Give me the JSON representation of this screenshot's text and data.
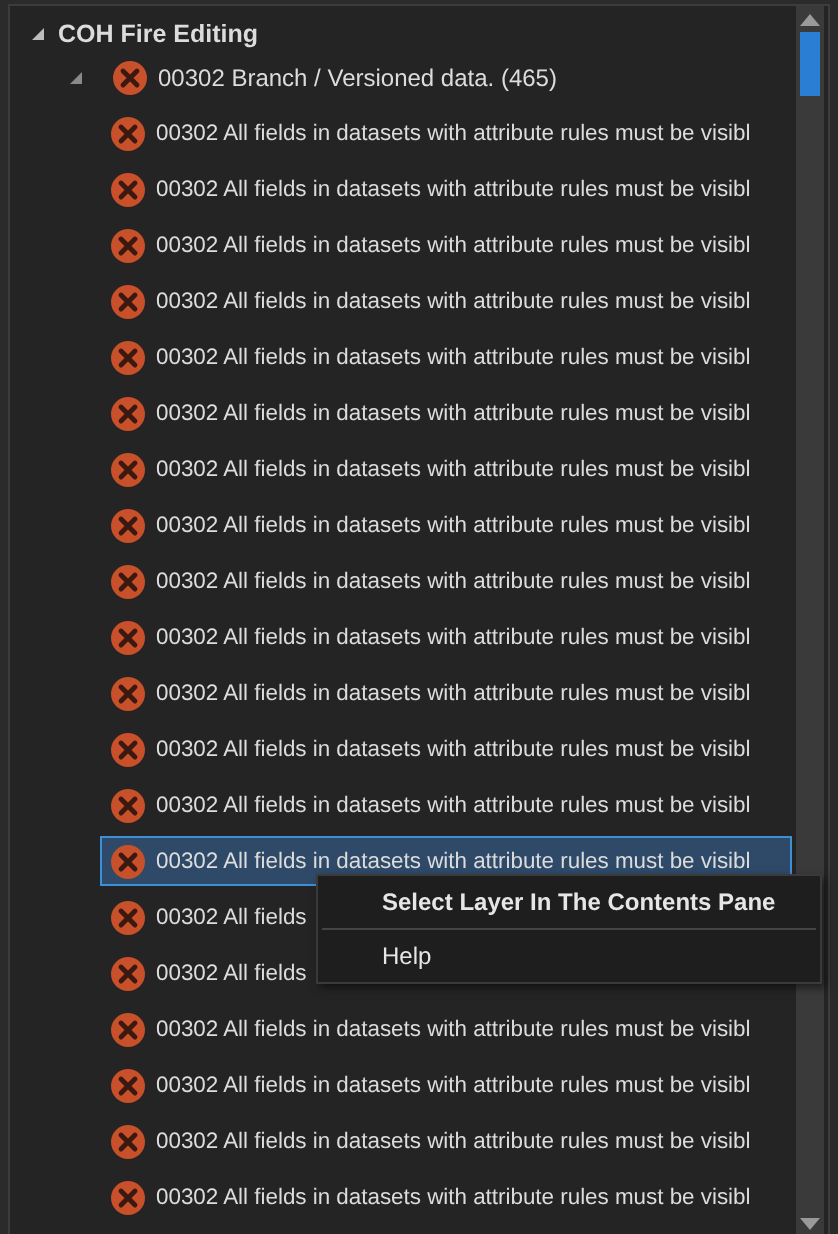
{
  "tree": {
    "label": "COH Fire Editing",
    "expanded": true,
    "children": [
      {
        "label": "00302 Branch / Versioned data. (465)",
        "expanded": true,
        "children": [
          {
            "label": "00302 All fields in datasets with attribute rules must be visibl",
            "selected": false
          },
          {
            "label": "00302 All fields in datasets with attribute rules must be visibl",
            "selected": false
          },
          {
            "label": "00302 All fields in datasets with attribute rules must be visibl",
            "selected": false
          },
          {
            "label": "00302 All fields in datasets with attribute rules must be visibl",
            "selected": false
          },
          {
            "label": "00302 All fields in datasets with attribute rules must be visibl",
            "selected": false
          },
          {
            "label": "00302 All fields in datasets with attribute rules must be visibl",
            "selected": false
          },
          {
            "label": "00302 All fields in datasets with attribute rules must be visibl",
            "selected": false
          },
          {
            "label": "00302 All fields in datasets with attribute rules must be visibl",
            "selected": false
          },
          {
            "label": "00302 All fields in datasets with attribute rules must be visibl",
            "selected": false
          },
          {
            "label": "00302 All fields in datasets with attribute rules must be visibl",
            "selected": false
          },
          {
            "label": "00302 All fields in datasets with attribute rules must be visibl",
            "selected": false
          },
          {
            "label": "00302 All fields in datasets with attribute rules must be visibl",
            "selected": false
          },
          {
            "label": "00302 All fields in datasets with attribute rules must be visibl",
            "selected": false
          },
          {
            "label": "00302 All fields in datasets with attribute rules must be visibl",
            "selected": true
          },
          {
            "label": "00302 All fields",
            "selected": false
          },
          {
            "label": "00302 All fields",
            "selected": false
          },
          {
            "label": "00302 All fields in datasets with attribute rules must be visibl",
            "selected": false
          },
          {
            "label": "00302 All fields in datasets with attribute rules must be visibl",
            "selected": false
          },
          {
            "label": "00302 All fields in datasets with attribute rules must be visibl",
            "selected": false
          },
          {
            "label": "00302 All fields in datasets with attribute rules must be visibl",
            "selected": false
          }
        ]
      }
    ]
  },
  "context_menu": {
    "items": [
      {
        "label": "Select Layer In The Contents Pane",
        "bold": true
      },
      {
        "label": "Help",
        "bold": false
      }
    ]
  }
}
